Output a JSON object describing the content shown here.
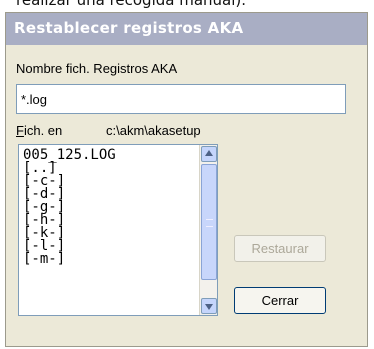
{
  "top_text": "realizar una recogida manual).",
  "dialog": {
    "title": "Restablecer registros AKA",
    "name_label": "Nombre fich. Registros AKA",
    "filename_value": "*.log",
    "in_label_accel": "F",
    "in_label_rest": "ich. en",
    "path": "c:\\akm\\akasetup",
    "list_items": [
      "005_125.LOG",
      "[..]",
      "[-c-]",
      "[-d-]",
      "[-g-]",
      "[-h-]",
      "[-k-]",
      "[-l-]",
      "[-m-]"
    ],
    "restore_label": "Restaurar",
    "close_label": "Cerrar"
  }
}
